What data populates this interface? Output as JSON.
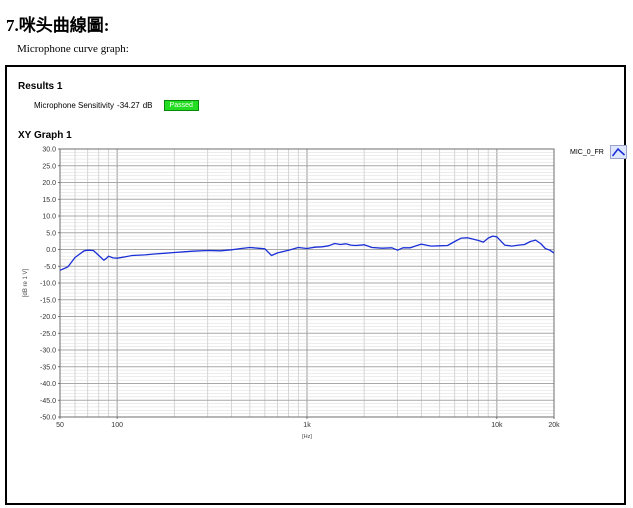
{
  "heading": "7.咪头曲線圖:",
  "subheading": "Microphone curve graph:",
  "results": {
    "title": "Results 1",
    "sensitivity_label": "Microphone Sensitivity",
    "sensitivity_value": "-34.27",
    "sensitivity_unit": "dB",
    "status": "Passed",
    "status_color": "#22dd22"
  },
  "chart_data": {
    "type": "line",
    "title": "XY Graph 1",
    "xlabel": "[Hz]",
    "ylabel": "[dB re 1 V]",
    "x_scale": "log",
    "xlim": [
      50,
      20000
    ],
    "ylim": [
      -50,
      30
    ],
    "grid": true,
    "legend_position": "top-right",
    "x_ticks": [
      {
        "value": 50,
        "label": "50"
      },
      {
        "value": 100,
        "label": "100"
      },
      {
        "value": 1000,
        "label": "1k"
      },
      {
        "value": 10000,
        "label": "10k"
      },
      {
        "value": 20000,
        "label": "20k"
      }
    ],
    "y_ticks": [
      {
        "value": 30,
        "label": "30.0"
      },
      {
        "value": 25,
        "label": "25.0"
      },
      {
        "value": 20,
        "label": "20.0"
      },
      {
        "value": 15,
        "label": "15.0"
      },
      {
        "value": 10,
        "label": "10.0"
      },
      {
        "value": 5,
        "label": "5.0"
      },
      {
        "value": 0,
        "label": "0.0"
      },
      {
        "value": -5,
        "label": "-5.0"
      },
      {
        "value": -10,
        "label": "-10.0"
      },
      {
        "value": -15,
        "label": "-15.0"
      },
      {
        "value": -20,
        "label": "-20.0"
      },
      {
        "value": -25,
        "label": "-25.0"
      },
      {
        "value": -30,
        "label": "-30.0"
      },
      {
        "value": -35,
        "label": "-35.0"
      },
      {
        "value": -40,
        "label": "-40.0"
      },
      {
        "value": -45,
        "label": "-45.0"
      },
      {
        "value": -50,
        "label": "-50.0"
      }
    ],
    "series": [
      {
        "name": "MIC_0_FR",
        "color": "#1a2fd6",
        "x": [
          50,
          55,
          60,
          63,
          67,
          70,
          75,
          80,
          85,
          88,
          90,
          95,
          100,
          110,
          120,
          140,
          160,
          180,
          200,
          250,
          300,
          350,
          400,
          450,
          500,
          550,
          600,
          650,
          700,
          750,
          800,
          900,
          1000,
          1100,
          1200,
          1300,
          1400,
          1500,
          1600,
          1700,
          1800,
          2000,
          2200,
          2500,
          2800,
          3000,
          3200,
          3500,
          4000,
          4500,
          5000,
          5500,
          6000,
          6500,
          7000,
          7500,
          8000,
          8500,
          9000,
          9500,
          10000,
          11000,
          12000,
          13000,
          14000,
          15000,
          16000,
          17000,
          18000,
          19000,
          20000
        ],
        "y": [
          -6.2,
          -5.2,
          -2.4,
          -1.5,
          -0.4,
          -0.2,
          -0.3,
          -1.8,
          -3.2,
          -2.6,
          -2.0,
          -2.5,
          -2.6,
          -2.2,
          -1.8,
          -1.6,
          -1.3,
          -1.1,
          -0.9,
          -0.5,
          -0.3,
          -0.4,
          -0.1,
          0.3,
          0.6,
          0.4,
          0.2,
          -1.8,
          -1.0,
          -0.6,
          -0.2,
          0.6,
          0.3,
          0.7,
          0.8,
          1.1,
          1.8,
          1.5,
          1.7,
          1.3,
          1.2,
          1.4,
          0.6,
          0.4,
          0.5,
          -0.2,
          0.5,
          0.5,
          1.6,
          1.0,
          1.1,
          1.2,
          2.4,
          3.4,
          3.5,
          3.1,
          2.7,
          2.2,
          3.4,
          4.0,
          3.8,
          1.3,
          1.0,
          1.3,
          1.5,
          2.4,
          2.8,
          1.8,
          0.3,
          -0.2,
          -1.0
        ]
      }
    ]
  }
}
